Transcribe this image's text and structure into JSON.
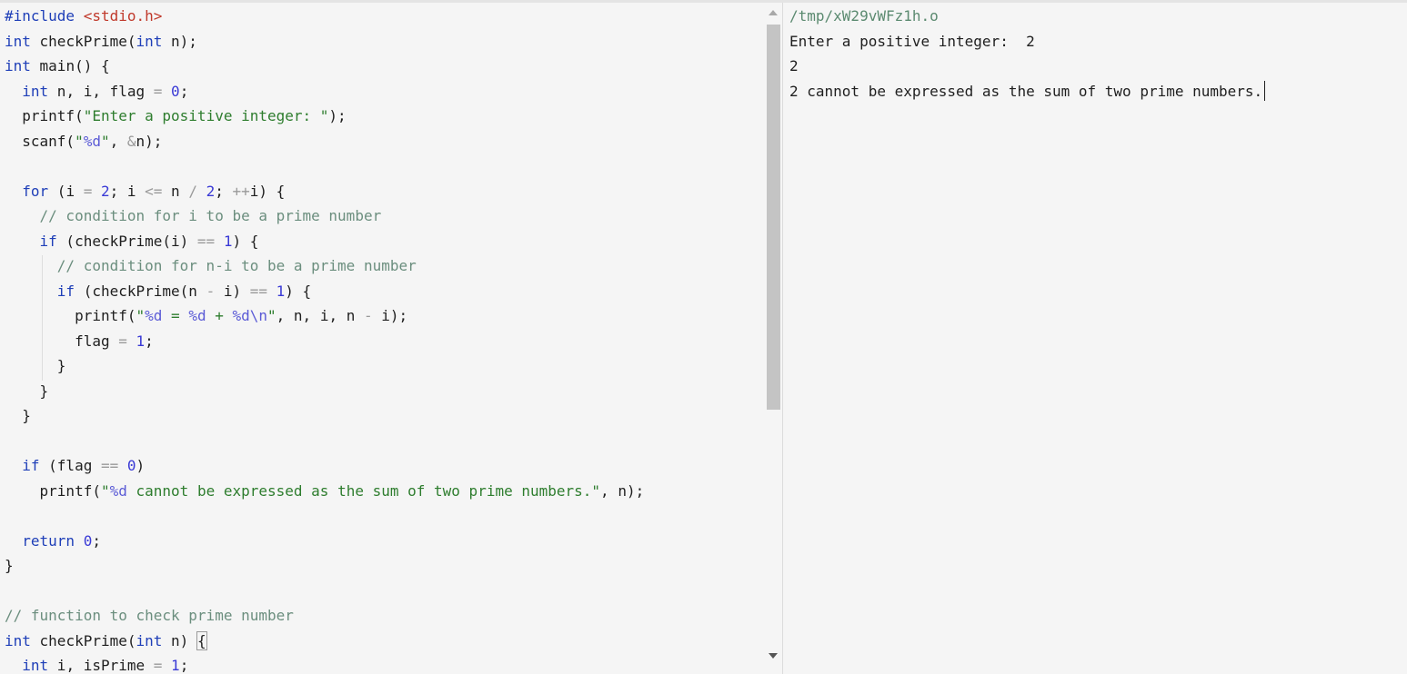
{
  "editor": {
    "lines": [
      [
        {
          "t": "#include ",
          "c": "pp"
        },
        {
          "t": "<stdio.h>",
          "c": "inc"
        }
      ],
      [
        {
          "t": "int",
          "c": "kw"
        },
        {
          "t": " checkPrime(",
          "c": "id"
        },
        {
          "t": "int",
          "c": "kw"
        },
        {
          "t": " n);",
          "c": "id"
        }
      ],
      [
        {
          "t": "int",
          "c": "kw"
        },
        {
          "t": " main() {",
          "c": "id"
        }
      ],
      [
        {
          "t": "  ",
          "c": "id"
        },
        {
          "t": "int",
          "c": "kw"
        },
        {
          "t": " n, i, flag ",
          "c": "id"
        },
        {
          "t": "=",
          "c": "op"
        },
        {
          "t": " ",
          "c": "id"
        },
        {
          "t": "0",
          "c": "num"
        },
        {
          "t": ";",
          "c": "id"
        }
      ],
      [
        {
          "t": "  printf(",
          "c": "id"
        },
        {
          "t": "\"Enter a positive integer: \"",
          "c": "str"
        },
        {
          "t": ");",
          "c": "id"
        }
      ],
      [
        {
          "t": "  scanf(",
          "c": "id"
        },
        {
          "t": "\"",
          "c": "str"
        },
        {
          "t": "%d",
          "c": "fmt"
        },
        {
          "t": "\"",
          "c": "str"
        },
        {
          "t": ", ",
          "c": "id"
        },
        {
          "t": "&",
          "c": "op"
        },
        {
          "t": "n);",
          "c": "id"
        }
      ],
      [],
      [
        {
          "t": "  ",
          "c": "id"
        },
        {
          "t": "for",
          "c": "kw"
        },
        {
          "t": " (i ",
          "c": "id"
        },
        {
          "t": "=",
          "c": "op"
        },
        {
          "t": " ",
          "c": "id"
        },
        {
          "t": "2",
          "c": "num"
        },
        {
          "t": "; i ",
          "c": "id"
        },
        {
          "t": "<=",
          "c": "op"
        },
        {
          "t": " n ",
          "c": "id"
        },
        {
          "t": "/",
          "c": "op"
        },
        {
          "t": " ",
          "c": "id"
        },
        {
          "t": "2",
          "c": "num"
        },
        {
          "t": "; ",
          "c": "id"
        },
        {
          "t": "++",
          "c": "op"
        },
        {
          "t": "i) {",
          "c": "id"
        }
      ],
      [
        {
          "t": "    // condition for i to be a prime number",
          "c": "cmt"
        }
      ],
      [
        {
          "t": "    ",
          "c": "id"
        },
        {
          "t": "if",
          "c": "kw"
        },
        {
          "t": " (checkPrime(i) ",
          "c": "id"
        },
        {
          "t": "==",
          "c": "op"
        },
        {
          "t": " ",
          "c": "id"
        },
        {
          "t": "1",
          "c": "num"
        },
        {
          "t": ") {",
          "c": "id"
        }
      ],
      [
        {
          "t": "      // condition for n-i to be a prime number",
          "c": "cmt"
        }
      ],
      [
        {
          "t": "      ",
          "c": "id"
        },
        {
          "t": "if",
          "c": "kw"
        },
        {
          "t": " (checkPrime(n ",
          "c": "id"
        },
        {
          "t": "-",
          "c": "op"
        },
        {
          "t": " i) ",
          "c": "id"
        },
        {
          "t": "==",
          "c": "op"
        },
        {
          "t": " ",
          "c": "id"
        },
        {
          "t": "1",
          "c": "num"
        },
        {
          "t": ") {",
          "c": "id"
        }
      ],
      [
        {
          "t": "        printf(",
          "c": "id"
        },
        {
          "t": "\"",
          "c": "str"
        },
        {
          "t": "%d",
          "c": "fmt"
        },
        {
          "t": " = ",
          "c": "str"
        },
        {
          "t": "%d",
          "c": "fmt"
        },
        {
          "t": " + ",
          "c": "str"
        },
        {
          "t": "%d\\n",
          "c": "fmt"
        },
        {
          "t": "\"",
          "c": "str"
        },
        {
          "t": ", n, i, n ",
          "c": "id"
        },
        {
          "t": "-",
          "c": "op"
        },
        {
          "t": " i);",
          "c": "id"
        }
      ],
      [
        {
          "t": "        flag ",
          "c": "id"
        },
        {
          "t": "=",
          "c": "op"
        },
        {
          "t": " ",
          "c": "id"
        },
        {
          "t": "1",
          "c": "num"
        },
        {
          "t": ";",
          "c": "id"
        }
      ],
      [
        {
          "t": "      }",
          "c": "id"
        }
      ],
      [
        {
          "t": "    }",
          "c": "id"
        }
      ],
      [
        {
          "t": "  }",
          "c": "id"
        }
      ],
      [],
      [
        {
          "t": "  ",
          "c": "id"
        },
        {
          "t": "if",
          "c": "kw"
        },
        {
          "t": " (flag ",
          "c": "id"
        },
        {
          "t": "==",
          "c": "op"
        },
        {
          "t": " ",
          "c": "id"
        },
        {
          "t": "0",
          "c": "num"
        },
        {
          "t": ")",
          "c": "id"
        }
      ],
      [
        {
          "t": "    printf(",
          "c": "id"
        },
        {
          "t": "\"",
          "c": "str"
        },
        {
          "t": "%d",
          "c": "fmt"
        },
        {
          "t": " cannot be expressed as the sum of two prime numbers.\"",
          "c": "str"
        },
        {
          "t": ", n);",
          "c": "id"
        }
      ],
      [],
      [
        {
          "t": "  ",
          "c": "id"
        },
        {
          "t": "return",
          "c": "kw"
        },
        {
          "t": " ",
          "c": "id"
        },
        {
          "t": "0",
          "c": "num"
        },
        {
          "t": ";",
          "c": "id"
        }
      ],
      [
        {
          "t": "}",
          "c": "id"
        }
      ],
      [],
      [
        {
          "t": "// function to check prime number",
          "c": "cmt"
        }
      ],
      [
        {
          "t": "int",
          "c": "kw"
        },
        {
          "t": " checkPrime(",
          "c": "id"
        },
        {
          "t": "int",
          "c": "kw"
        },
        {
          "t": " n) ",
          "c": "id"
        },
        {
          "t": "{",
          "c": "id",
          "box": true
        }
      ],
      [
        {
          "t": "  ",
          "c": "id"
        },
        {
          "t": "int",
          "c": "kw"
        },
        {
          "t": " i, isPrime ",
          "c": "id"
        },
        {
          "t": "=",
          "c": "op"
        },
        {
          "t": " ",
          "c": "id"
        },
        {
          "t": "1",
          "c": "num"
        },
        {
          "t": ";",
          "c": "id"
        }
      ]
    ]
  },
  "console": {
    "path": "/tmp/xW29vWFz1h.o",
    "lines": [
      "Enter a positive integer:  2",
      "2",
      "2 cannot be expressed as the sum of two prime numbers."
    ]
  }
}
